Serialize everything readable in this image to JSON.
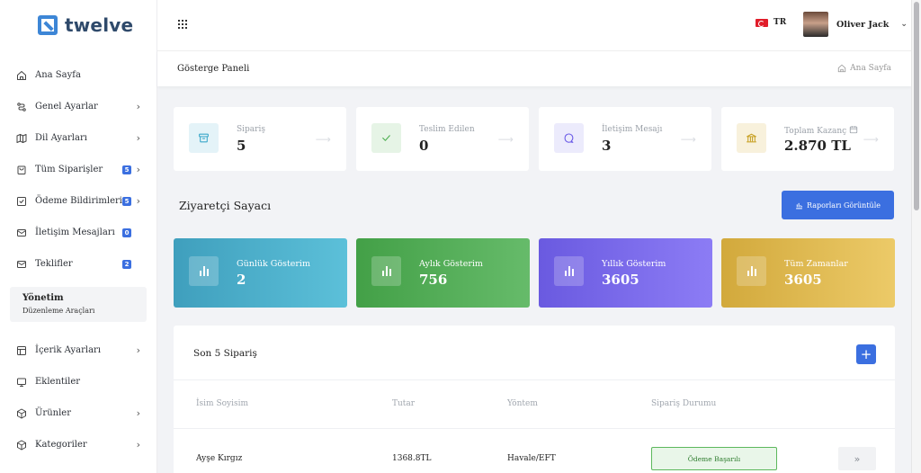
{
  "brand": {
    "name": "twelve"
  },
  "sidebar": {
    "items": [
      {
        "label": "Ana Sayfa",
        "icon": "home-icon",
        "badge": "",
        "chevron": false
      },
      {
        "label": "Genel Ayarlar",
        "icon": "route-icon",
        "badge": "",
        "chevron": true
      },
      {
        "label": "Dil Ayarları",
        "icon": "map-icon",
        "badge": "",
        "chevron": true
      },
      {
        "label": "Tüm Siparişler",
        "icon": "bag-icon",
        "badge": "5",
        "chevron": true
      },
      {
        "label": "Ödeme Bildirimleri",
        "icon": "check-square-icon",
        "badge": "5",
        "chevron": true
      },
      {
        "label": "İletişim Mesajları",
        "icon": "mail-icon",
        "badge": "0",
        "chevron": false
      },
      {
        "label": "Teklifler",
        "icon": "mail-icon",
        "badge": "2",
        "chevron": false
      }
    ],
    "section": {
      "title": "Yönetim",
      "subtitle": "Düzenleme Araçları"
    },
    "items2": [
      {
        "label": "İçerik Ayarları",
        "icon": "layout-icon",
        "chevron": true
      },
      {
        "label": "Eklentiler",
        "icon": "monitor-icon",
        "chevron": false
      },
      {
        "label": "Ürünler",
        "icon": "box-icon",
        "chevron": true
      },
      {
        "label": "Kategoriler",
        "icon": "box-icon",
        "chevron": true
      }
    ]
  },
  "topbar": {
    "language": "TR",
    "user_name": "Oliver Jack"
  },
  "breadcrumb": {
    "page_title": "Gösterge Paneli",
    "home_label": "Ana Sayfa"
  },
  "stats": [
    {
      "label": "Sipariş",
      "value": "5",
      "icon": "archive-icon",
      "color": "#3aa7c9",
      "bg": "#e4f3f8"
    },
    {
      "label": "Teslim Edilen",
      "value": "0",
      "icon": "check-icon",
      "color": "#4caf50",
      "bg": "#e6f4e6"
    },
    {
      "label": "İletişim Mesajı",
      "value": "3",
      "icon": "chat-icon",
      "color": "#6b5ce7",
      "bg": "#ecebfc"
    },
    {
      "label": "Toplam Kazanç",
      "value": "2.870 TL",
      "icon": "bank-icon",
      "color": "#c9a227",
      "bg": "#f8f1dc"
    }
  ],
  "visitors": {
    "title": "Ziyaretçi Sayacı",
    "report_button": "Raporları Görüntüle",
    "cards": [
      {
        "label": "Günlük Gösterim",
        "value": "2",
        "gradient": "linear-gradient(90deg,#3f9fbd,#5cc0d9)"
      },
      {
        "label": "Aylık Gösterim",
        "value": "756",
        "gradient": "linear-gradient(90deg,#43a047,#66bb6a)"
      },
      {
        "label": "Yıllık Gösterim",
        "value": "3605",
        "gradient": "linear-gradient(90deg,#6a5ae0,#8c7cf5)"
      },
      {
        "label": "Tüm Zamanlar",
        "value": "3605",
        "gradient": "linear-gradient(90deg,#d2a93c,#ecca68)"
      }
    ]
  },
  "orders": {
    "title": "Son 5 Sipariş",
    "add_label": "+",
    "columns": [
      "İsim Soyisim",
      "Tutar",
      "Yöntem",
      "Sipariş Durumu"
    ],
    "rows": [
      {
        "name": "Ayşe Kırgız",
        "amount": "1368.8TL",
        "method": "Havale/EFT",
        "status": "Ödeme Başarılı",
        "action": "»"
      }
    ]
  }
}
